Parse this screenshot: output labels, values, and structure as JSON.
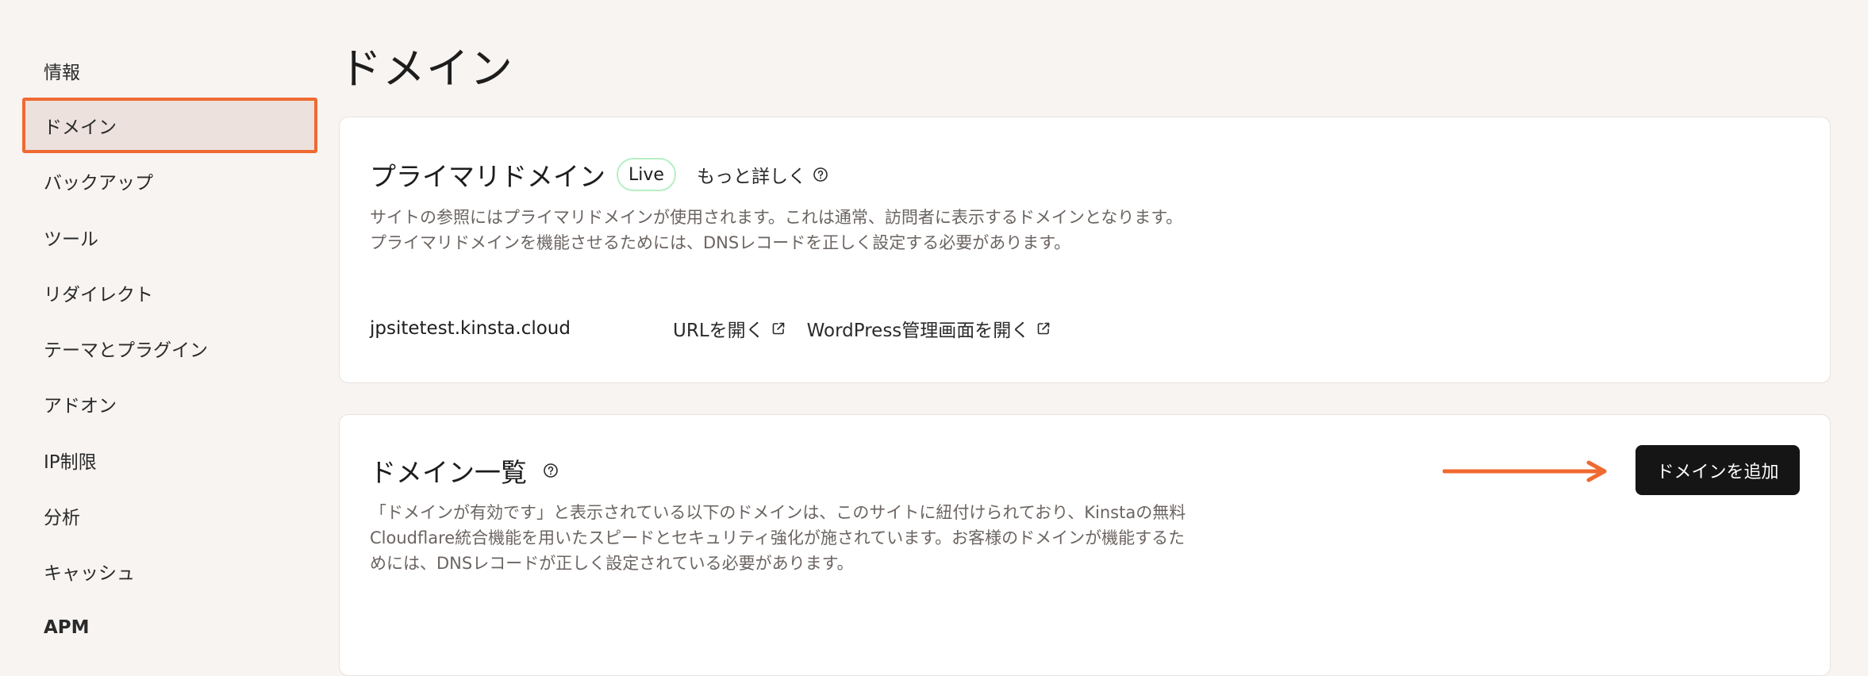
{
  "sidebar": {
    "items": [
      {
        "label": "情報"
      },
      {
        "label": "ドメイン"
      },
      {
        "label": "バックアップ"
      },
      {
        "label": "ツール"
      },
      {
        "label": "リダイレクト"
      },
      {
        "label": "テーマとプラグイン"
      },
      {
        "label": "アドオン"
      },
      {
        "label": "IP制限"
      },
      {
        "label": "分析"
      },
      {
        "label": "キャッシュ"
      },
      {
        "label": "APM"
      }
    ]
  },
  "page": {
    "title": "ドメイン"
  },
  "primary": {
    "heading": "プライマリドメイン",
    "badge": "Live",
    "learn_more": "もっと詳しく",
    "description": "サイトの参照にはプライマリドメインが使用されます。これは通常、訪問者に表示するドメインとなります。プライマリドメインを機能させるためには、DNSレコードを正しく設定する必要があります。",
    "domain": "jpsitetest.kinsta.cloud",
    "open_url": "URLを開く",
    "open_wp_admin": "WordPress管理画面を開く"
  },
  "domain_list": {
    "heading": "ドメイン一覧",
    "description": "「ドメインが有効です」と表示されている以下のドメインは、このサイトに紐付けられており、Kinstaの無料Cloudflare統合機能を用いたスピードとセキュリティ強化が施されています。お客様のドメインが機能するためには、DNSレコードが正しく設定されている必要があります。",
    "add_button": "ドメインを追加"
  },
  "colors": {
    "accent": "#ef6a31",
    "active_bg": "#ece1dc",
    "button_bg": "#151515",
    "live_border": "#b6efc4"
  }
}
